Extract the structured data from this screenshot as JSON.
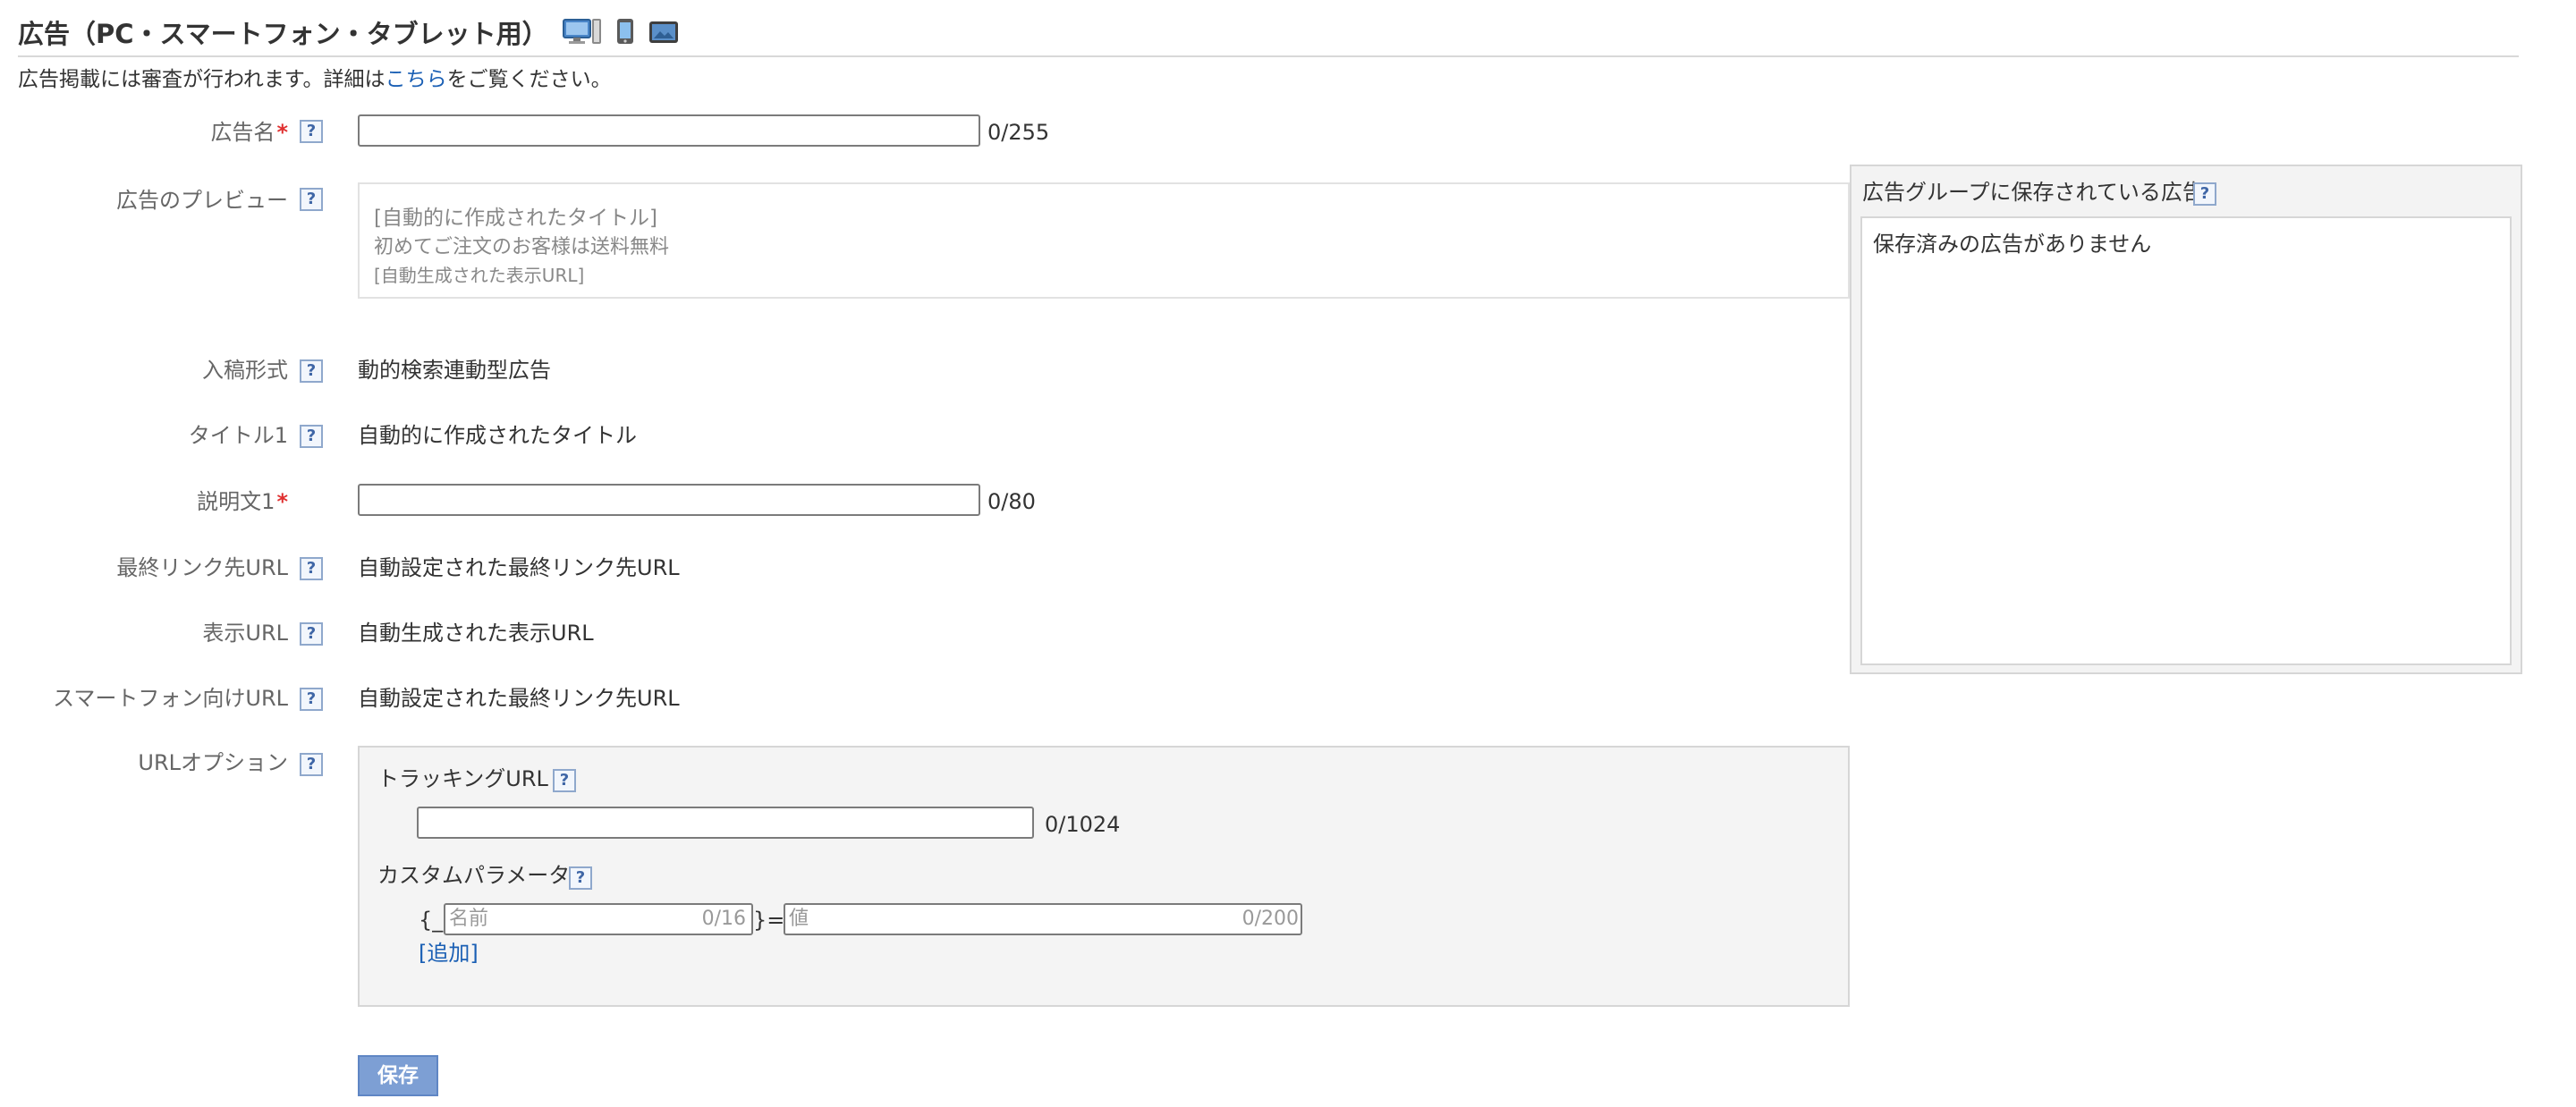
{
  "header": {
    "title": "広告（PC・スマートフォン・タブレット用）",
    "device_icons": [
      "desktop-icon",
      "smartphone-icon",
      "tablet-icon"
    ]
  },
  "notice": {
    "prefix": "広告掲載には審査が行われます。詳細は",
    "link": "こちら",
    "suffix": "をご覧ください。"
  },
  "form": {
    "ad_name": {
      "label": "広告名",
      "required_mark": "*",
      "value": "",
      "counter": "0/255"
    },
    "preview": {
      "label": "広告のプレビュー",
      "line1": "[自動的に作成されたタイトル]",
      "line2": "初めてご注文のお客様は送料無料",
      "line3": "[自動生成された表示URL]"
    },
    "submission_type": {
      "label": "入稿形式",
      "value": "動的検索連動型広告"
    },
    "title1": {
      "label": "タイトル1",
      "value": "自動的に作成されたタイトル"
    },
    "description1": {
      "label": "説明文1",
      "required_mark": "*",
      "value": "",
      "counter": "0/80"
    },
    "final_url": {
      "label": "最終リンク先URL",
      "value": "自動設定された最終リンク先URL"
    },
    "display_url": {
      "label": "表示URL",
      "value": "自動生成された表示URL"
    },
    "smartphone_url": {
      "label": "スマートフォン向けURL",
      "value": "自動設定された最終リンク先URL"
    },
    "url_option": {
      "label": "URLオプション",
      "tracking_label": "トラッキングURL",
      "tracking_value": "",
      "tracking_counter": "0/1024",
      "custom_param_label": "カスタムパラメータ",
      "brace_open": "{_",
      "name_placeholder": "名前",
      "name_counter": "0/16",
      "equals": "}=",
      "value_placeholder": "値",
      "value_counter": "0/200",
      "add_link": "[追加]"
    },
    "help_mark": "?",
    "save_button": "保存"
  },
  "saved_ads": {
    "title": "広告グループに保存されている広告",
    "empty": "保存済みの広告がありません"
  },
  "colors": {
    "link": "#1a5fb4",
    "required": "#e03030",
    "save_button_bg": "#7d9fd4",
    "panel_bg": "#f4f4f4"
  }
}
